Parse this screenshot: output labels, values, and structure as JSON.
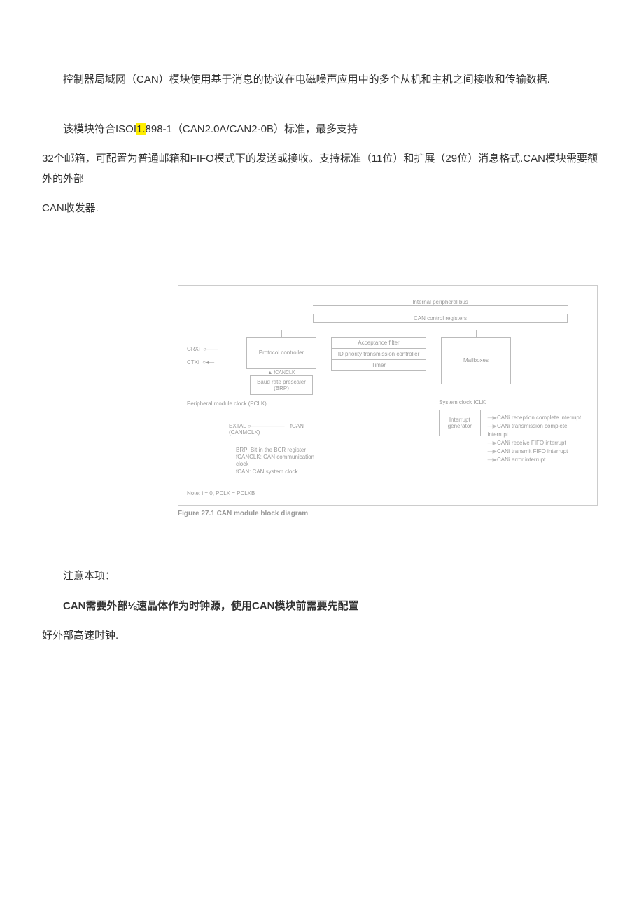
{
  "para1": "控制器局域网（CAN）模块使用基于消息的协议在电磁噪声应用中的多个从机和主机之间接收和传输数据.",
  "para2a": "该模块符合ISOI",
  "para2hl": "1.",
  "para2b": "898-1（CAN2.0A/CAN2·0B）标准，最多支持",
  "para3": "32个邮箱，可配置为普通邮箱和FIFO模式下的发送或接收。支持标准（11位）和扩展（29位）消息格式.CAN模块需要额外的外部",
  "para4": "CAN收发器.",
  "attention_label": "注意本项：",
  "para5a": "CAN需要外部⅛速晶体作为时钟源，使用CAN模块前需要先配置",
  "para6": "好外部高速时钟.",
  "fig": {
    "bus": "Internal peripheral bus",
    "ctrlreg": "CAN control registers",
    "crx": "CRXi",
    "ctx": "CTXi",
    "protocol": "Protocol controller",
    "fcanclk_lbl": "fCANCLK",
    "brp_box": "Baud rate prescaler (BRP)",
    "accfilter": "Acceptance filter",
    "idprio": "ID priority transmission controller",
    "timer": "Timer",
    "mailboxes": "Mailboxes",
    "pclk": "Peripheral module clock (PCLK)",
    "extal": "EXTAL",
    "fcan": "fCAN (CANMCLK)",
    "sysclk": "System clock fCLK",
    "intgen": "Interrupt generator",
    "int1": "CANi reception complete interrupt",
    "int2": "CANi transmission complete interrupt",
    "int3": "CANi receive FIFO interrupt",
    "int4": "CANi transmit FIFO interrupt",
    "int5": "CANi error interrupt",
    "note_brp": "BRP:         Bit in the BCR register",
    "note_fcanclk": "fCANCLK: CAN communication clock",
    "note_fcan": "fCAN:        CAN system clock",
    "footnote": "Note:     i = 0, PCLK = PCLKB",
    "caption": "Figure 27.1     CAN module block diagram"
  }
}
